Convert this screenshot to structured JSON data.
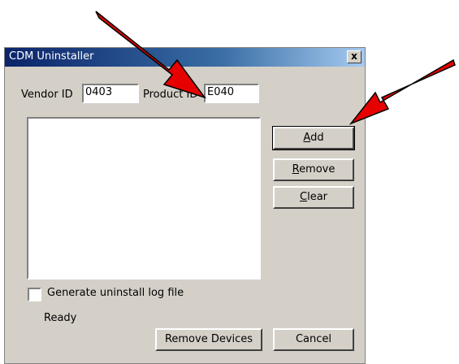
{
  "window": {
    "title": "CDM Uninstaller",
    "close_label": "x"
  },
  "fields": {
    "vendor_label": "Vendor ID",
    "vendor_value": "0403",
    "product_label": "Product ID",
    "product_value": "E040"
  },
  "buttons": {
    "add": "Add",
    "remove": "Remove",
    "clear": "Clear",
    "remove_devices": "Remove Devices",
    "cancel": "Cancel"
  },
  "options": {
    "log_label": "Generate uninstall log file",
    "log_checked": false
  },
  "status": "Ready",
  "annotations": {
    "arrow_color": "#e60000"
  }
}
